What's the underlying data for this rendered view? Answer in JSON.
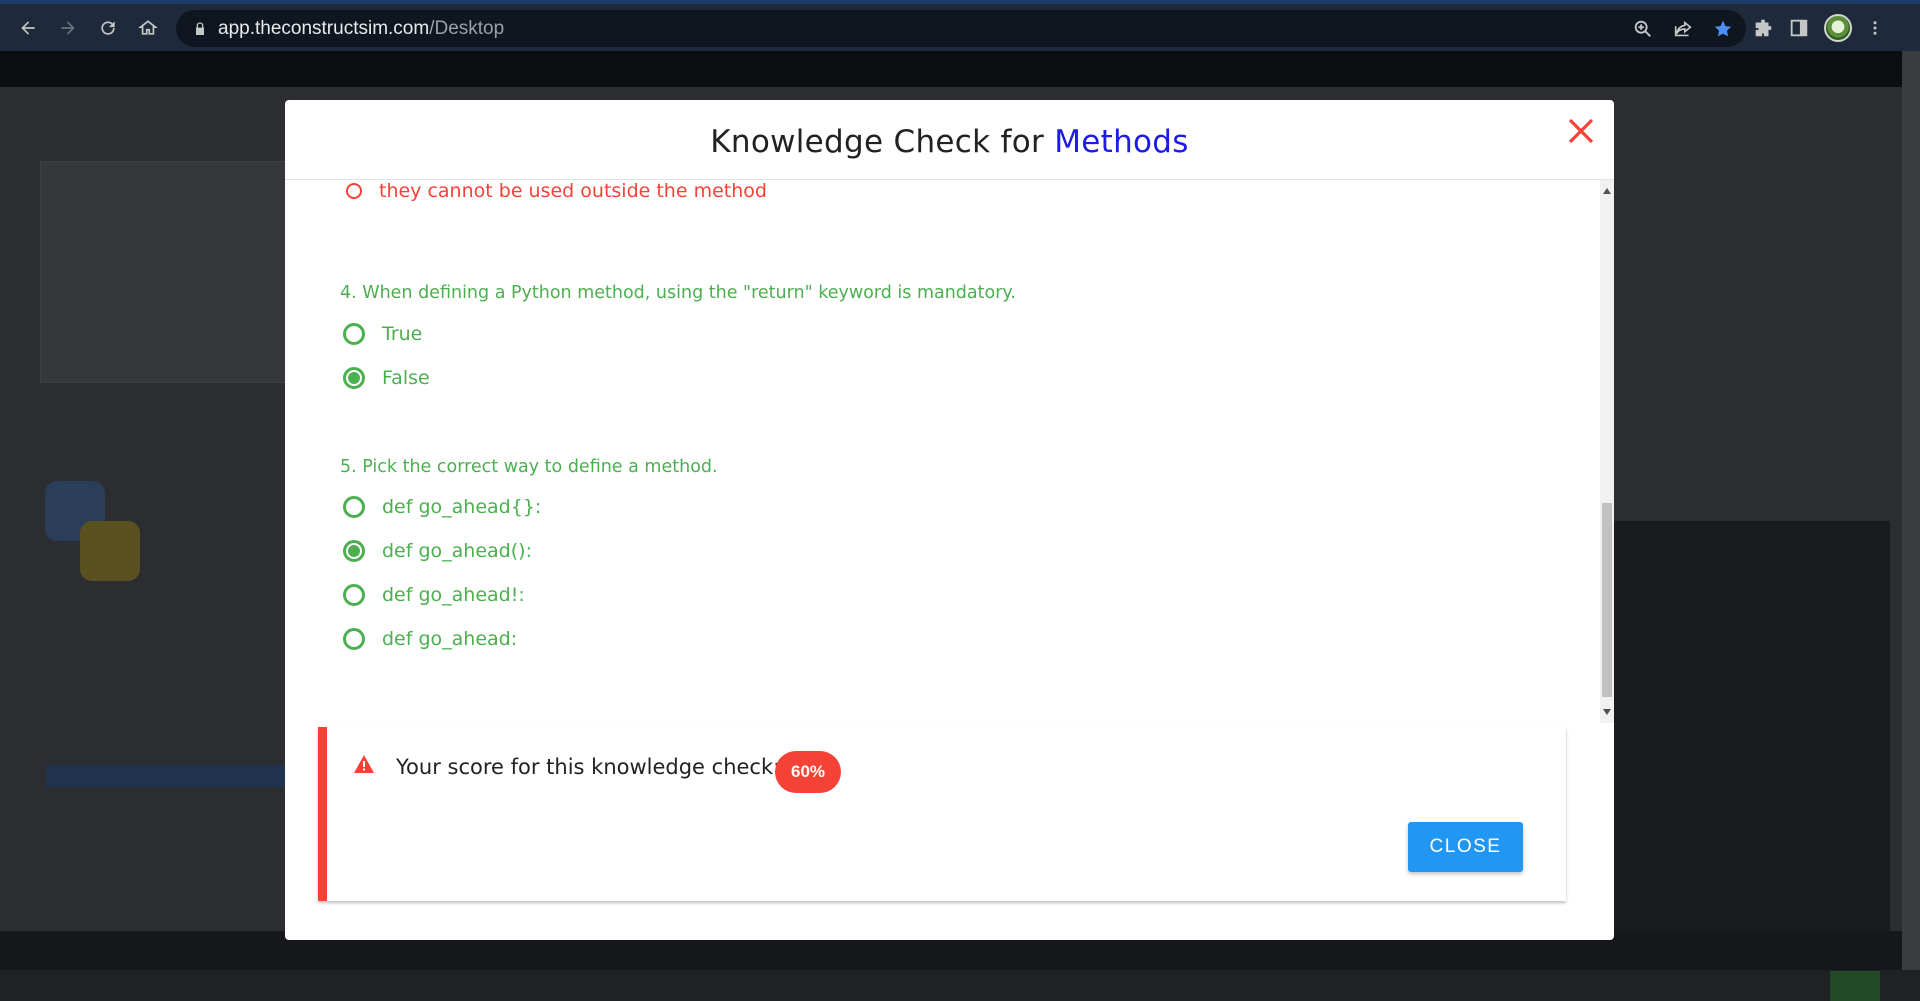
{
  "browser": {
    "url_host": "app.theconstructsim.com",
    "url_path": "/Desktop",
    "icons": [
      "back-icon",
      "forward-icon",
      "reload-icon",
      "home-icon",
      "lock-icon",
      "zoom-icon",
      "share-icon",
      "bookmark-star-icon",
      "extensions-icon",
      "side-panel-icon",
      "profile-avatar",
      "menu-icon"
    ]
  },
  "modal": {
    "title_prefix": "Knowledge Check for",
    "title_accent": "Methods",
    "accent_color": "#1c1ce6",
    "prev_option": "they cannot be used outside the method",
    "questions": [
      {
        "text": "4. When defining a Python method, using the \"return\" keyword is mandatory.",
        "options": [
          {
            "label": "True",
            "selected": false
          },
          {
            "label": "False",
            "selected": true
          }
        ]
      },
      {
        "text": "5. Pick the correct way to define a method.",
        "options": [
          {
            "label": "def go_ahead{}:",
            "selected": false
          },
          {
            "label": "def go_ahead():",
            "selected": true
          },
          {
            "label": "def go_ahead!:",
            "selected": false
          },
          {
            "label": "def go_ahead:",
            "selected": false
          }
        ]
      }
    ],
    "score": {
      "text": "Your score for this knowledge check:",
      "value": "60%",
      "color": "#f44336"
    },
    "close_label": "CLOSE"
  }
}
